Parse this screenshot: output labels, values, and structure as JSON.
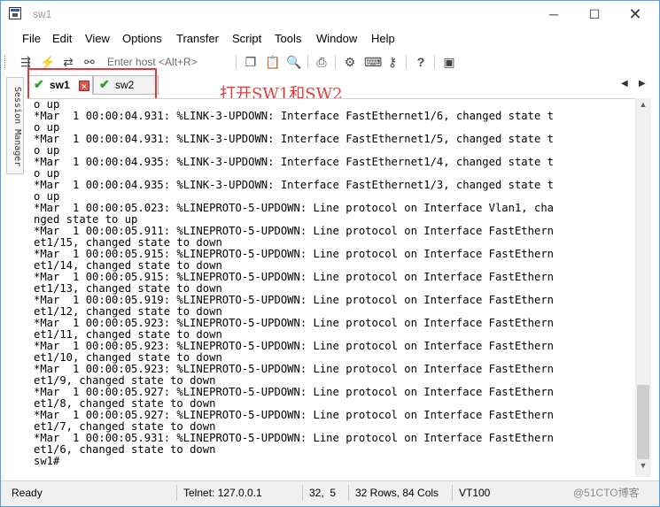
{
  "window": {
    "title": "sw1",
    "controls": {
      "minimize": "─",
      "maximize": "☐",
      "close": "✕"
    }
  },
  "menu": {
    "items": [
      "File",
      "Edit",
      "View",
      "Options",
      "Transfer",
      "Script",
      "Tools",
      "Window",
      "Help"
    ]
  },
  "toolbar": {
    "host_placeholder": "Enter host <Alt+R>"
  },
  "tabs": [
    {
      "label": "sw1",
      "status": "connected",
      "active": true
    },
    {
      "label": "sw2",
      "status": "connected",
      "active": false
    }
  ],
  "annotation": {
    "text": "打开SW1和SW2",
    "color": "#e23a3a"
  },
  "sidebar": {
    "label": "Session Manager"
  },
  "terminal": {
    "lines": [
      "o up",
      "*Mar  1 00:00:04.931: %LINK-3-UPDOWN: Interface FastEthernet1/6, changed state t",
      "o up",
      "*Mar  1 00:00:04.931: %LINK-3-UPDOWN: Interface FastEthernet1/5, changed state t",
      "o up",
      "*Mar  1 00:00:04.935: %LINK-3-UPDOWN: Interface FastEthernet1/4, changed state t",
      "o up",
      "*Mar  1 00:00:04.935: %LINK-3-UPDOWN: Interface FastEthernet1/3, changed state t",
      "o up",
      "*Mar  1 00:00:05.023: %LINEPROTO-5-UPDOWN: Line protocol on Interface Vlan1, cha",
      "nged state to up",
      "*Mar  1 00:00:05.911: %LINEPROTO-5-UPDOWN: Line protocol on Interface FastEthern",
      "et1/15, changed state to down",
      "*Mar  1 00:00:05.915: %LINEPROTO-5-UPDOWN: Line protocol on Interface FastEthern",
      "et1/14, changed state to down",
      "*Mar  1 00:00:05.915: %LINEPROTO-5-UPDOWN: Line protocol on Interface FastEthern",
      "et1/13, changed state to down",
      "*Mar  1 00:00:05.919: %LINEPROTO-5-UPDOWN: Line protocol on Interface FastEthern",
      "et1/12, changed state to down",
      "*Mar  1 00:00:05.923: %LINEPROTO-5-UPDOWN: Line protocol on Interface FastEthern",
      "et1/11, changed state to down",
      "*Mar  1 00:00:05.923: %LINEPROTO-5-UPDOWN: Line protocol on Interface FastEthern",
      "et1/10, changed state to down",
      "*Mar  1 00:00:05.923: %LINEPROTO-5-UPDOWN: Line protocol on Interface FastEthern",
      "et1/9, changed state to down",
      "*Mar  1 00:00:05.927: %LINEPROTO-5-UPDOWN: Line protocol on Interface FastEthern",
      "et1/8, changed state to down",
      "*Mar  1 00:00:05.927: %LINEPROTO-5-UPDOWN: Line protocol on Interface FastEthern",
      "et1/7, changed state to down",
      "*Mar  1 00:00:05.931: %LINEPROTO-5-UPDOWN: Line protocol on Interface FastEthern",
      "et1/6, changed state to down",
      "sw1#"
    ]
  },
  "status": {
    "state": "Ready",
    "connection": "Telnet: 127.0.0.1",
    "cursor": "32,  5",
    "size": "32 Rows, 84 Cols",
    "emulation": "VT100"
  },
  "watermark": "@51CTO博客"
}
